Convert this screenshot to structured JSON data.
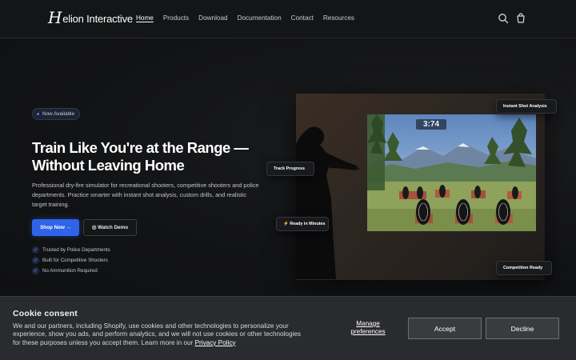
{
  "header": {
    "logo_initial": "H",
    "logo_rest": "elion Interactive",
    "nav": [
      "Home",
      "Products",
      "Download",
      "Documentation",
      "Contact",
      "Resources"
    ],
    "active_nav": "Home",
    "icons": [
      "search-icon",
      "cart-icon"
    ]
  },
  "hero": {
    "badge": "Now Available",
    "title": "Train Like You're at the Range — Without Leaving Home",
    "description": "Professional dry-fire simulator for recreational shooters, competitive shooters and police departments. Practice smarter with instant shot analysis, custom drills, and realistic target training.",
    "primary_button": "Shop Now →",
    "secondary_button": "◎ Watch Demo",
    "trust_items": [
      "Trusted by Police Departments",
      "Built for Competitive Shooters",
      "No Ammunition Required"
    ]
  },
  "preview": {
    "timer": "3:74",
    "callouts": {
      "instant": "Instant Shot Analysis",
      "progress": "Track Progress",
      "ready": "⚡  Ready in Minutes",
      "competition": "Competition Ready"
    }
  },
  "cookie": {
    "title": "Cookie consent",
    "text": "We and our partners, including Shopify, use cookies and other technologies to personalize your experience, show you ads, and perform analytics, and we will not use cookies or other technologies for these purposes unless you accept them. Learn more in our ",
    "link": "Privacy Policy",
    "manage": "Manage preferences",
    "accept": "Accept",
    "decline": "Decline"
  },
  "colors": {
    "background": "#111214",
    "accent": "#2f63e8",
    "cookie_bg": "#2a2b2e"
  }
}
